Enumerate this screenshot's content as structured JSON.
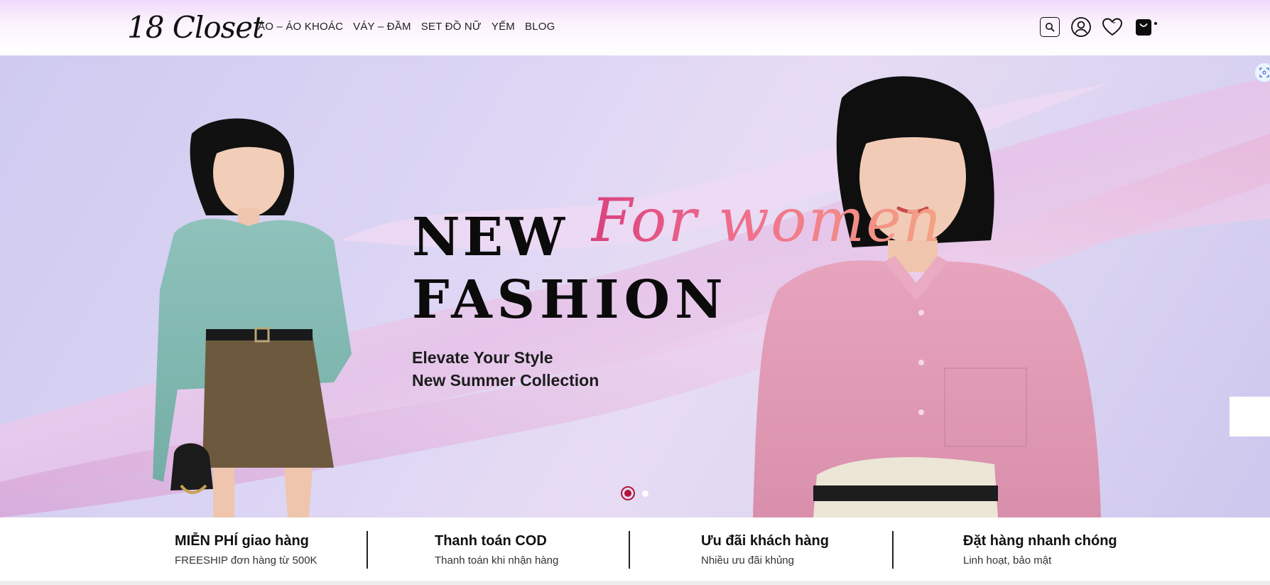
{
  "header": {
    "logo": "18 Closet",
    "nav": [
      "ÁO – ÁO KHOÁC",
      "VÁY – ĐẦM",
      "SET ĐỒ NỮ",
      "YẾM",
      "BLOG"
    ],
    "icons": [
      "search-icon",
      "user-icon",
      "heart-icon",
      "cart-icon"
    ]
  },
  "hero": {
    "headline_line1": "NEW",
    "headline_line2": "FASHION",
    "script_text": "For women",
    "subline1": "Elevate Your Style",
    "subline2": "New Summer Collection",
    "slide_count": 2,
    "active_slide": 1
  },
  "features": [
    {
      "title": "MIỄN PHÍ giao hàng",
      "subtitle": "FREESHIP đơn hàng từ 500K"
    },
    {
      "title": "Thanh toán COD",
      "subtitle": "Thanh toán khi nhận hàng"
    },
    {
      "title": "Ưu đãi khách hàng",
      "subtitle": "Nhiều ưu đãi khủng"
    },
    {
      "title": "Đặt hàng nhanh chóng",
      "subtitle": "Linh hoạt, bảo mật"
    }
  ],
  "colors": {
    "accent": "#b2163a",
    "script_start": "#d9427d",
    "script_end": "#f4a383"
  }
}
